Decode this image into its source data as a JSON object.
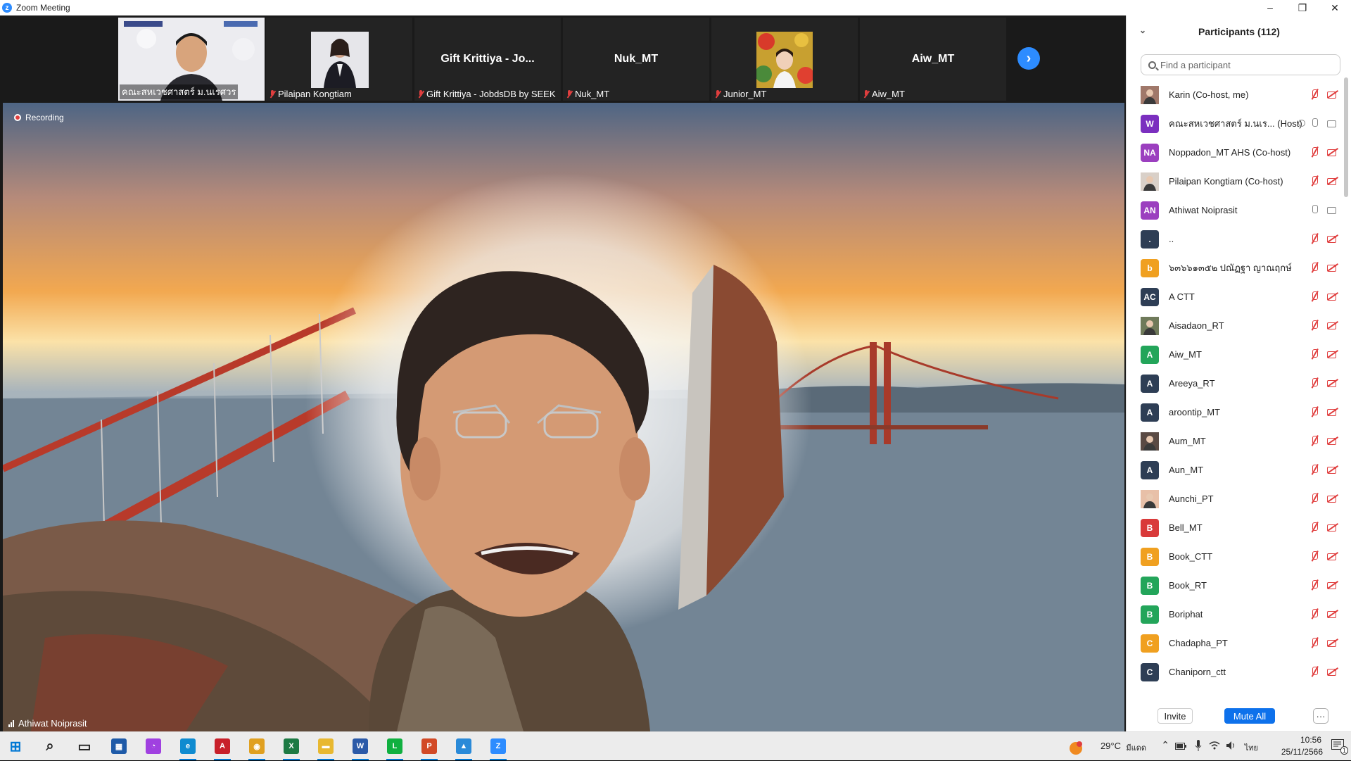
{
  "window": {
    "title": "Zoom Meeting",
    "minimize": "–",
    "restore": "❐",
    "close": "✕"
  },
  "thumbnails": [
    {
      "name": "คณะสหเวชศาสตร์ ม.นเรศวร",
      "type": "video",
      "muted": false
    },
    {
      "name": "Pilaipan Kongtiam",
      "type": "photo",
      "muted": true
    },
    {
      "name": "Gift Krittiya - JobdsDB by SEEK",
      "big_name": "Gift Krittiya - Jo...",
      "type": "name",
      "muted": true
    },
    {
      "name": "Nuk_MT",
      "big_name": "Nuk_MT",
      "type": "name",
      "muted": true
    },
    {
      "name": "Junior_MT",
      "type": "photo",
      "muted": true
    },
    {
      "name": "Aiw_MT",
      "big_name": "Aiw_MT",
      "type": "name",
      "muted": true
    }
  ],
  "next_arrow": "›",
  "main_video": {
    "recording_label": "Recording",
    "speaker_name": "Athiwat Noiprasit"
  },
  "panel": {
    "title": "Participants (112)",
    "collapse_glyph": "⌄",
    "search_placeholder": "Find a participant",
    "participants": [
      {
        "name": "Karin (Co-host, me)",
        "initials": "",
        "color": "#a0786a",
        "mic": "off",
        "cam": "off",
        "photo": true
      },
      {
        "name": "คณะสหเวชศาสตร์ ม.นเร... (Host)",
        "initials": "W",
        "color": "#7b2fbf",
        "mic": "on",
        "cam": "on",
        "share": true
      },
      {
        "name": "Noppadon_MT AHS (Co-host)",
        "initials": "NA",
        "color": "#9b3fbf",
        "mic": "off",
        "cam": "off"
      },
      {
        "name": "Pilaipan Kongtiam (Co-host)",
        "initials": "",
        "color": "#d9d0c8",
        "mic": "off",
        "cam": "off",
        "photo": true
      },
      {
        "name": "Athiwat Noiprasit",
        "initials": "AN",
        "color": "#9b3fbf",
        "mic": "on",
        "cam": "on"
      },
      {
        "name": "..",
        "initials": ".",
        "color": "#2e3e55",
        "mic": "off",
        "cam": "off"
      },
      {
        "name": "๖๓๖๖๑๓๕๒ ปณัฏฐา ญาณฤกษ์",
        "initials": "b",
        "color": "#f0a020",
        "mic": "off",
        "cam": "off"
      },
      {
        "name": "A CTT",
        "initials": "AC",
        "color": "#2e3e55",
        "mic": "off",
        "cam": "off"
      },
      {
        "name": "Aisadaon_RT",
        "initials": "",
        "color": "#6f7a5a",
        "mic": "off",
        "cam": "off",
        "photo": true
      },
      {
        "name": "Aiw_MT",
        "initials": "A",
        "color": "#23a55a",
        "mic": "off",
        "cam": "off"
      },
      {
        "name": "Areeya_RT",
        "initials": "A",
        "color": "#2e3e55",
        "mic": "off",
        "cam": "off"
      },
      {
        "name": "aroontip_MT",
        "initials": "A",
        "color": "#2e3e55",
        "mic": "off",
        "cam": "off"
      },
      {
        "name": "Aum_MT",
        "initials": "",
        "color": "#5a4a44",
        "mic": "off",
        "cam": "off",
        "photo": true
      },
      {
        "name": "Aun_MT",
        "initials": "A",
        "color": "#2e3e55",
        "mic": "off",
        "cam": "off"
      },
      {
        "name": "Aunchi_PT",
        "initials": "",
        "color": "#e8c0a8",
        "mic": "off",
        "cam": "off",
        "photo": true
      },
      {
        "name": "Bell_MT",
        "initials": "B",
        "color": "#d93a3a",
        "mic": "off",
        "cam": "off"
      },
      {
        "name": "Book_CTT",
        "initials": "B",
        "color": "#f0a020",
        "mic": "off",
        "cam": "off"
      },
      {
        "name": "Book_RT",
        "initials": "B",
        "color": "#23a55a",
        "mic": "off",
        "cam": "off"
      },
      {
        "name": "Boriphat",
        "initials": "B",
        "color": "#23a55a",
        "mic": "off",
        "cam": "off"
      },
      {
        "name": "Chadapha_PT",
        "initials": "C",
        "color": "#f0a020",
        "mic": "off",
        "cam": "off"
      },
      {
        "name": "Chaniporn_ctt",
        "initials": "C",
        "color": "#2e3e55",
        "mic": "off",
        "cam": "off"
      }
    ],
    "invite_label": "Invite",
    "mute_all_label": "Mute All",
    "more_label": "···"
  },
  "taskbar": {
    "apps": [
      "start-icon",
      "search-icon",
      "task-view-icon",
      "store-icon",
      "messenger-icon",
      "edge-icon",
      "pdf-icon",
      "chrome-icon",
      "excel-icon",
      "explorer-icon",
      "word-icon",
      "line-icon",
      "powerpoint-icon",
      "photos-icon",
      "zoom-icon"
    ],
    "weather": "29°C",
    "weather_desc": "มีแดด",
    "lang": "ไทย",
    "time": "10:56",
    "date": "25/11/2566",
    "notification_count": "1"
  },
  "colors": {
    "accent": "#2d8cff",
    "mute_all": "#0e71eb",
    "muted_red": "#e03e3e"
  }
}
